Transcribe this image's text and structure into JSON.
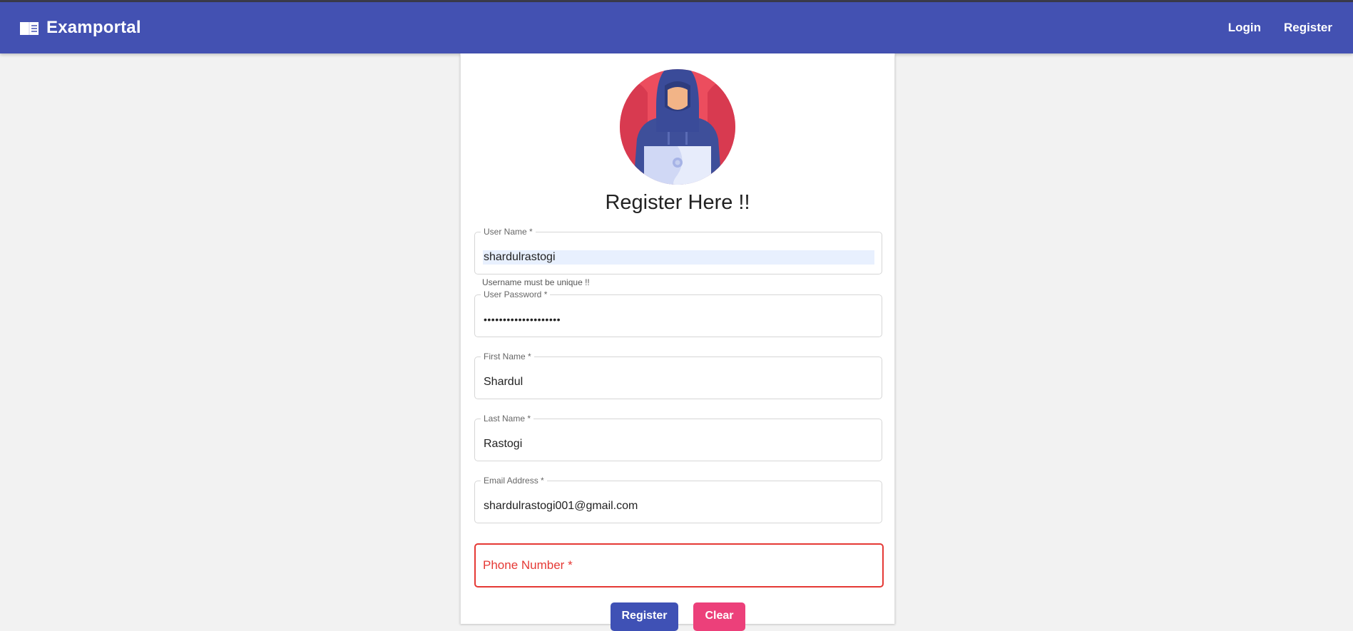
{
  "navbar": {
    "brand": "Examportal",
    "brand_icon": "book-icon",
    "links": [
      "Login",
      "Register"
    ],
    "color": "#4351b2"
  },
  "form": {
    "title": "Register Here !!",
    "avatar_icon": "hooded-hacker-avatar",
    "username": {
      "label": "User Name *",
      "value": "shardulrastogi",
      "hint": "Username must be unique !!"
    },
    "password": {
      "label": "User Password *",
      "value": "••••••••••••••••••••"
    },
    "first_name": {
      "label": "First Name *",
      "value": "Shardul"
    },
    "last_name": {
      "label": "Last Name *",
      "value": "Rastogi"
    },
    "email": {
      "label": "Email Address *",
      "value": "shardulrastogi001@gmail.com"
    },
    "phone": {
      "placeholder": "Phone Number *",
      "value": "",
      "error_color": "#e53935"
    },
    "register_button": "Register",
    "clear_button": "Clear",
    "register_color": "#3f51b5",
    "clear_color": "#ec407a"
  }
}
